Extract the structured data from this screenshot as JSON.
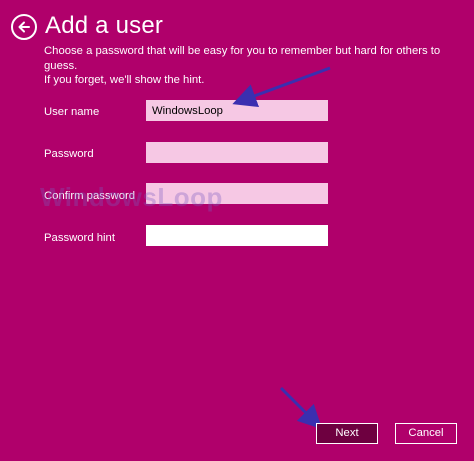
{
  "header": {
    "title": "Add a user",
    "back_icon": "back-arrow-icon"
  },
  "description": {
    "line1": "Choose a password that will be easy for you to remember but hard for others to guess.",
    "line2": "If you forget, we'll show the hint."
  },
  "form": {
    "username_label": "User name",
    "username_value": "WindowsLoop",
    "password_label": "Password",
    "password_value": "",
    "confirm_label": "Confirm password",
    "confirm_value": "",
    "hint_label": "Password hint",
    "hint_value": ""
  },
  "watermark": {
    "text": "WindowsLoop"
  },
  "buttons": {
    "next_label": "Next",
    "cancel_label": "Cancel"
  },
  "colors": {
    "background": "#b0006b",
    "input_fill": "#f6c8e4",
    "hint_fill": "#ffffff",
    "next_fill": "#6e0040",
    "annotation_arrow": "#3a2fb0"
  }
}
